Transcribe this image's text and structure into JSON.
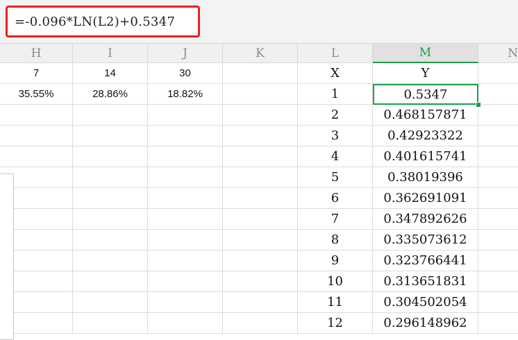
{
  "formula_bar": {
    "formula": "=-0.096*LN(L2)+0.5347"
  },
  "columns": [
    "H",
    "I",
    "J",
    "K",
    "L",
    "M",
    "N"
  ],
  "active_column": "M",
  "left_table": {
    "headers": [
      "7",
      "14",
      "30"
    ],
    "values": [
      "35.55%",
      "28.86%",
      "18.82%"
    ]
  },
  "xy_table": {
    "x_header": "X",
    "y_header": "Y",
    "rows": [
      {
        "x": "1",
        "y": "0.5347"
      },
      {
        "x": "2",
        "y": "0.468157871"
      },
      {
        "x": "3",
        "y": "0.42923322"
      },
      {
        "x": "4",
        "y": "0.401615741"
      },
      {
        "x": "5",
        "y": "0.38019396"
      },
      {
        "x": "6",
        "y": "0.362691091"
      },
      {
        "x": "7",
        "y": "0.347892626"
      },
      {
        "x": "8",
        "y": "0.335073612"
      },
      {
        "x": "9",
        "y": "0.323766441"
      },
      {
        "x": "10",
        "y": "0.313651831"
      },
      {
        "x": "11",
        "y": "0.304502054"
      },
      {
        "x": "12",
        "y": "0.296148962"
      }
    ]
  },
  "colors": {
    "accent": "#1d9e4a",
    "highlight": "#e8231e"
  }
}
